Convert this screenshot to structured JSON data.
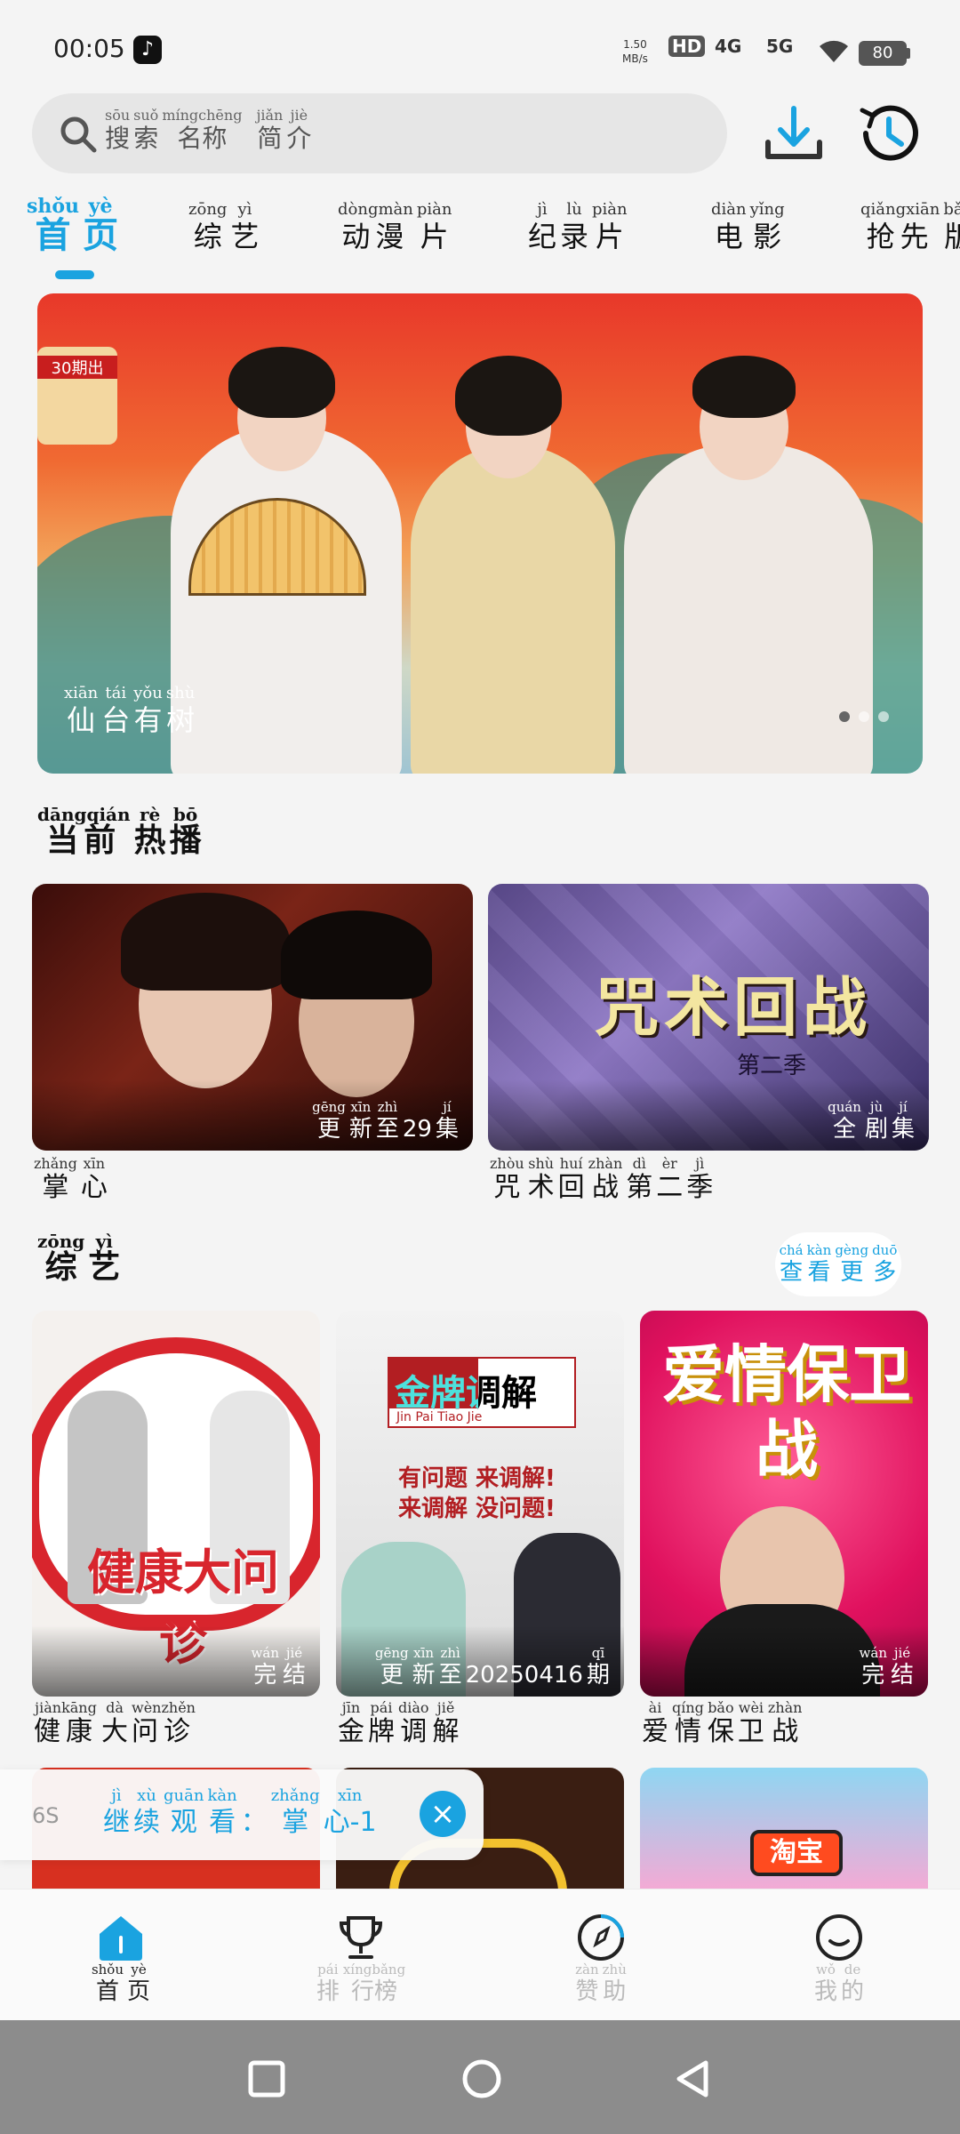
{
  "status_bar": {
    "time": "00:05",
    "speed_value": "1.50",
    "speed_unit": "MB/s",
    "hd_label": "HD",
    "net1": "4G",
    "net2": "5G",
    "battery": "80"
  },
  "search": {
    "placeholder": [
      {
        "py": "sōu",
        "hz": "搜"
      },
      {
        "py": "suǒ",
        "hz": "索"
      },
      {
        "py": "míngchēng",
        "hz": "名称"
      },
      {
        "py": "jiǎn",
        "hz": "简"
      },
      {
        "py": "jiè",
        "hz": "介"
      }
    ]
  },
  "tabs": [
    {
      "py": [
        "shǒu",
        "yè"
      ],
      "hz": [
        "首",
        "页"
      ]
    },
    {
      "py": [
        "zōng",
        "yì"
      ],
      "hz": [
        "综",
        "艺"
      ]
    },
    {
      "py": [
        "dòngmàn",
        "piàn"
      ],
      "hz": [
        "动漫",
        "片"
      ]
    },
    {
      "py": [
        "jì",
        "lù",
        "piàn"
      ],
      "hz": [
        "纪",
        "录",
        "片"
      ]
    },
    {
      "py": [
        "diàn",
        "yǐng"
      ],
      "hz": [
        "电",
        "影"
      ]
    },
    {
      "py": [
        "qiǎngxiān",
        "bǎn"
      ],
      "hz": [
        "抢先",
        "版"
      ]
    }
  ],
  "banner": {
    "caption_py": [
      "xiān",
      "tái",
      "yǒu",
      "shù"
    ],
    "caption_hz": [
      "仙",
      "台",
      "有",
      "树"
    ],
    "badge_text": "30期出"
  },
  "current_hot": {
    "title_py": [
      "dāngqián",
      "rè",
      "bō"
    ],
    "title_hz": [
      "当前",
      "热",
      "播"
    ],
    "items": [
      {
        "badge_py": [
          "gēng",
          "xīn",
          "zhì",
          "",
          "",
          "jí"
        ],
        "badge_hz": [
          "更",
          "新",
          "至",
          "29",
          "",
          "集"
        ],
        "name_py": [
          "zhǎng",
          "xīn"
        ],
        "name_hz": [
          "掌",
          "心"
        ]
      },
      {
        "badge_py": [
          "quán",
          "jù",
          "jí"
        ],
        "badge_hz": [
          "全",
          "剧",
          "集"
        ],
        "name_py": [
          "zhòu",
          "shù",
          "huí",
          "zhàn",
          "dì",
          "èr",
          "jì"
        ],
        "name_hz": [
          "咒",
          "术",
          "回",
          "战",
          "第",
          "二",
          "季"
        ],
        "poster_text": "咒术回战",
        "poster_sub": "第二季"
      }
    ]
  },
  "variety": {
    "title_py": [
      "zōng",
      "yì"
    ],
    "title_hz": [
      "综",
      "艺"
    ],
    "more_py": [
      "chá",
      "kàn",
      "gèng",
      "duō"
    ],
    "more_hz": [
      "查",
      "看",
      "更",
      "多"
    ],
    "items": [
      {
        "badge_py": [
          "wán",
          "jié"
        ],
        "badge_hz": [
          "完",
          "结"
        ],
        "name_py": [
          "jiànkāng",
          "dà",
          "wènzhěn"
        ],
        "name_hz": [
          "健康",
          "大",
          "问诊"
        ],
        "poster_text": "健康大问诊"
      },
      {
        "badge_py": [
          "gēng",
          "xīn",
          "zhì",
          "",
          "qī"
        ],
        "badge_hz": [
          "更",
          "新",
          "至",
          "20250416",
          "期"
        ],
        "name_py": [
          "jīn",
          "pái",
          "diào",
          "jiě"
        ],
        "name_hz": [
          "金",
          "牌",
          "调",
          "解"
        ],
        "poster_text": "金牌调解",
        "poster_sub": "Jin Pai  Tiao Jie",
        "poster_line1": "有问题 来调解!",
        "poster_line2": "来调解 没问题!"
      },
      {
        "badge_py": [
          "wán",
          "jié"
        ],
        "badge_hz": [
          "完",
          "结"
        ],
        "name_py": [
          "ài",
          "qíng",
          "bǎo",
          "wèi",
          "zhàn"
        ],
        "name_hz": [
          "爱",
          "情",
          "保",
          "卫",
          "战"
        ],
        "poster_text": "爱情保卫战"
      }
    ],
    "peek_text": "淘宝"
  },
  "toast": {
    "count": "6S",
    "text_py": [
      "jì",
      "xù",
      "guān",
      "kàn",
      "",
      "zhǎng",
      "xīn"
    ],
    "text_hz": [
      "继",
      "续",
      "观",
      "看",
      "：",
      "掌",
      "心-1"
    ],
    "close_icon": "×"
  },
  "bottom_nav": [
    {
      "py": [
        "shǒu",
        "yè"
      ],
      "hz": [
        "首",
        "页"
      ],
      "icon": "home-icon"
    },
    {
      "py": [
        "pái",
        "xíngbǎng"
      ],
      "hz": [
        "排",
        "行榜"
      ],
      "icon": "trophy-icon"
    },
    {
      "py": [
        "zàn",
        "zhù"
      ],
      "hz": [
        "赞",
        "助"
      ],
      "icon": "compass-icon"
    },
    {
      "py": [
        "wǒ",
        "de"
      ],
      "hz": [
        "我",
        "的"
      ],
      "icon": "smile-icon"
    }
  ],
  "colors": {
    "accent": "#1aa3e0",
    "background": "#f4f4f4"
  }
}
